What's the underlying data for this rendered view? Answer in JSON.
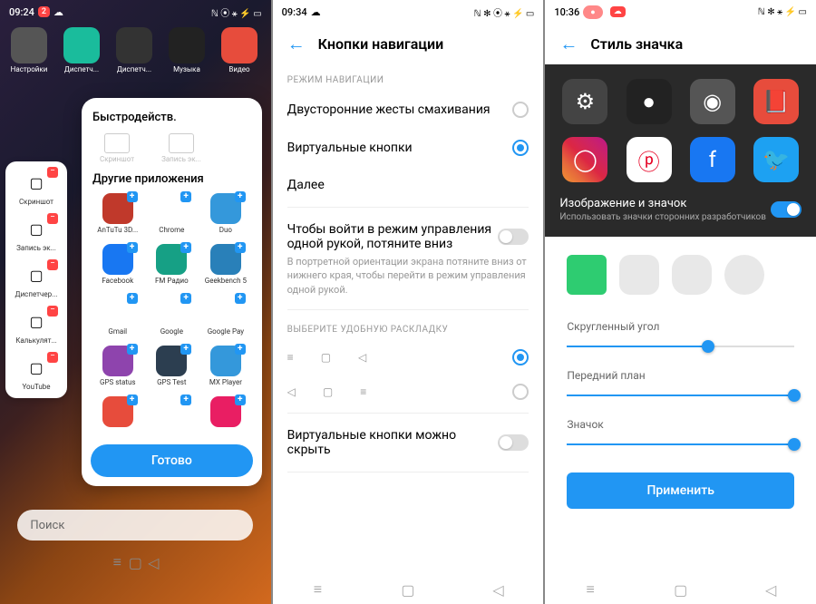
{
  "p1": {
    "time": "09:24",
    "badge": "2",
    "status_icons": "ℕ ⦿ ⚹ ⚡ ▭",
    "top": [
      {
        "lb": "Настройки",
        "bg": "#555"
      },
      {
        "lb": "Диспетч...",
        "bg": "#1abc9c"
      },
      {
        "lb": "Диспетч...",
        "bg": "#333"
      },
      {
        "lb": "Музыка",
        "bg": "#222"
      },
      {
        "lb": "Видео",
        "bg": "#e74c3c"
      }
    ],
    "sheet_title": "Быстродейств.",
    "quick": [
      {
        "lb": "Скриншот"
      },
      {
        "lb": "Запись эк..."
      }
    ],
    "apps_title": "Другие приложения",
    "apps": [
      {
        "lb": "AnTuTu 3D...",
        "bg": "#c0392b"
      },
      {
        "lb": "Chrome",
        "bg": "#fff"
      },
      {
        "lb": "Duo",
        "bg": "#3498db"
      },
      {
        "lb": "Facebook",
        "bg": "#1877f2"
      },
      {
        "lb": "FM Радио",
        "bg": "#16a085"
      },
      {
        "lb": "Geekbench 5",
        "bg": "#2980b9"
      },
      {
        "lb": "Gmail",
        "bg": "#fff"
      },
      {
        "lb": "Google",
        "bg": "#fff"
      },
      {
        "lb": "Google Pay",
        "bg": "#fff"
      },
      {
        "lb": "GPS status",
        "bg": "#8e44ad"
      },
      {
        "lb": "GPS Test",
        "bg": "#2c3e50"
      },
      {
        "lb": "MX Player",
        "bg": "#3498db"
      },
      {
        "lb": "",
        "bg": "#e74c3c"
      },
      {
        "lb": "",
        "bg": "#fff"
      },
      {
        "lb": "",
        "bg": "#e91e63"
      }
    ],
    "done": "Готово",
    "sidebar": [
      {
        "lb": "Скриншот"
      },
      {
        "lb": "Запись эк..."
      },
      {
        "lb": "Диспетчер..."
      },
      {
        "lb": "Калькулят..."
      },
      {
        "lb": "YouTube"
      }
    ],
    "search": "Поиск"
  },
  "p2": {
    "time": "09:34",
    "status_icons": "ℕ ✻ ⦿ ⚹ ⚡ ▭",
    "title": "Кнопки навигации",
    "sec1": "РЕЖИМ НАВИГАЦИИ",
    "opt1": "Двусторонние жесты смахивания",
    "opt2": "Виртуальные кнопки",
    "opt3": "Далее",
    "row2": "Чтобы войти в режим управления одной рукой, потяните вниз",
    "sub2": "В портретной ориентации экрана потяните вниз от нижнего края, чтобы перейти в режим управления одной рукой.",
    "sec2": "ВЫБЕРИТЕ УДОБНУЮ РАСКЛАДКУ",
    "row3": "Виртуальные кнопки можно скрыть"
  },
  "p3": {
    "time": "10:36",
    "status_icons": "ℕ ✻ ⚹ ⚡ ▭",
    "title": "Стиль значка",
    "panel_title": "Изображение и значок",
    "panel_sub": "Использовать значки сторонних разработчиков",
    "s1": "Скругленный угол",
    "s2": "Передний план",
    "s3": "Значок",
    "apply": "Применить",
    "slider_vals": {
      "s1": 62,
      "s2": 100,
      "s3": 100
    }
  }
}
